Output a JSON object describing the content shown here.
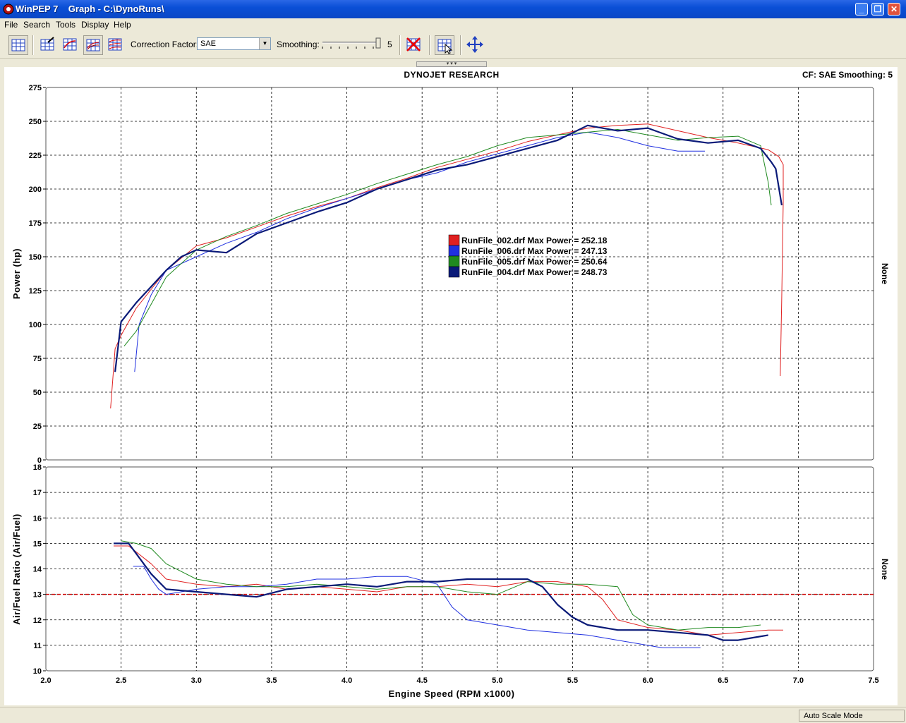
{
  "window": {
    "title": "WinPEP 7    Graph - C:\\DynoRuns\\",
    "minimize_label": "_",
    "maximize_label": "❐",
    "close_label": "✕"
  },
  "menu": [
    "File",
    "Search",
    "Tools",
    "Display",
    "Help"
  ],
  "toolbar": {
    "correction_label": "Correction Factor:",
    "correction_value": "SAE",
    "smoothing_label": "Smoothing:",
    "smoothing_value": "5"
  },
  "graph": {
    "header_title": "DYNOJET RESEARCH",
    "header_right": "CF: SAE  Smoothing: 5",
    "right_axis_label_top": "None",
    "right_axis_label_bottom": "None"
  },
  "status": {
    "mode": "Auto Scale Mode"
  },
  "colors": {
    "run002": "#e02020",
    "run006": "#2030e0",
    "run005": "#208a20",
    "run004": "#0a1a78",
    "afr_ref": "#cc0000",
    "grid": "#000000"
  },
  "chart_data": [
    {
      "type": "line",
      "xlabel": "",
      "ylabel": "Power (hp)",
      "xlim": [
        2.0,
        7.5
      ],
      "ylim": [
        0,
        275
      ],
      "xticks": [
        "2.0",
        "2.5",
        "3.0",
        "3.5",
        "4.0",
        "4.5",
        "5.0",
        "5.5",
        "6.0",
        "6.5",
        "7.0",
        "7.5"
      ],
      "yticks": [
        "0",
        "25",
        "50",
        "75",
        "100",
        "125",
        "150",
        "175",
        "200",
        "225",
        "250",
        "275"
      ],
      "grid": true,
      "legend": [
        "RunFile_002.drf Max Power = 252.18",
        "RunFile_006.drf Max Power = 247.13",
        "RunFile_005.drf Max Power = 250.64",
        "RunFile_004.drf Max Power = 248.73"
      ],
      "series": [
        {
          "name": "RunFile_002.drf",
          "color": "#e02020",
          "x": [
            2.43,
            2.46,
            2.5,
            2.6,
            2.8,
            3.0,
            3.2,
            3.4,
            3.6,
            3.8,
            4.0,
            4.2,
            4.4,
            4.6,
            4.8,
            5.0,
            5.2,
            5.4,
            5.6,
            5.8,
            6.0,
            6.2,
            6.4,
            6.6,
            6.8,
            6.87,
            6.9,
            6.9,
            6.89,
            6.88
          ],
          "y": [
            38,
            82,
            92,
            112,
            140,
            158,
            164,
            172,
            180,
            187,
            193,
            201,
            208,
            216,
            222,
            228,
            235,
            240,
            245,
            247,
            248,
            243,
            238,
            234,
            229,
            224,
            218,
            190,
            120,
            62
          ]
        },
        {
          "name": "RunFile_006.drf",
          "color": "#2030e0",
          "x": [
            2.59,
            2.62,
            2.7,
            2.8,
            3.0,
            3.2,
            3.4,
            3.6,
            3.8,
            4.0,
            4.2,
            4.4,
            4.6,
            4.8,
            5.0,
            5.2,
            5.4,
            5.6,
            5.8,
            6.0,
            6.2,
            6.38
          ],
          "y": [
            65,
            100,
            122,
            140,
            150,
            160,
            168,
            178,
            186,
            193,
            200,
            207,
            212,
            220,
            226,
            232,
            238,
            242,
            238,
            232,
            228,
            228
          ]
        },
        {
          "name": "RunFile_005.drf",
          "color": "#208a20",
          "x": [
            2.52,
            2.6,
            2.8,
            3.0,
            3.2,
            3.4,
            3.6,
            3.8,
            4.0,
            4.2,
            4.4,
            4.6,
            4.8,
            5.0,
            5.2,
            5.4,
            5.6,
            5.8,
            6.0,
            6.2,
            6.4,
            6.6,
            6.75,
            6.8,
            6.82
          ],
          "y": [
            84,
            95,
            135,
            155,
            165,
            173,
            182,
            189,
            196,
            204,
            211,
            218,
            224,
            232,
            238,
            240,
            242,
            244,
            240,
            236,
            238,
            239,
            232,
            205,
            188
          ]
        },
        {
          "name": "RunFile_004.drf",
          "color": "#0a1a78",
          "x": [
            2.46,
            2.5,
            2.6,
            2.7,
            2.8,
            2.9,
            3.0,
            3.2,
            3.4,
            3.6,
            3.8,
            4.0,
            4.2,
            4.4,
            4.6,
            4.8,
            5.0,
            5.2,
            5.4,
            5.6,
            5.8,
            6.0,
            6.2,
            6.4,
            6.6,
            6.75,
            6.82,
            6.85,
            6.89
          ],
          "y": [
            65,
            102,
            116,
            128,
            140,
            150,
            155,
            153,
            167,
            175,
            183,
            190,
            200,
            207,
            214,
            218,
            224,
            230,
            236,
            247,
            243,
            245,
            237,
            234,
            236,
            230,
            220,
            215,
            188
          ]
        }
      ]
    },
    {
      "type": "line",
      "xlabel": "Engine Speed (RPM x1000)",
      "ylabel": "Air/Fuel Ratio (Air/Fuel)",
      "xlim": [
        2.0,
        7.5
      ],
      "ylim": [
        10,
        18
      ],
      "xticks": [
        "2.0",
        "2.5",
        "3.0",
        "3.5",
        "4.0",
        "4.5",
        "5.0",
        "5.5",
        "6.0",
        "6.5",
        "7.0",
        "7.5"
      ],
      "yticks": [
        "10",
        "11",
        "12",
        "13",
        "14",
        "15",
        "16",
        "17",
        "18"
      ],
      "grid": true,
      "reference_line": 13,
      "series": [
        {
          "name": "RunFile_002.drf",
          "color": "#e02020",
          "x": [
            2.45,
            2.55,
            2.7,
            2.8,
            3.0,
            3.2,
            3.4,
            3.6,
            3.8,
            4.0,
            4.2,
            4.4,
            4.6,
            4.8,
            5.0,
            5.2,
            5.4,
            5.6,
            5.7,
            5.8,
            6.0,
            6.2,
            6.4,
            6.6,
            6.8,
            6.9
          ],
          "y": [
            14.9,
            14.9,
            14.2,
            13.6,
            13.4,
            13.3,
            13.4,
            13.2,
            13.3,
            13.2,
            13.1,
            13.3,
            13.3,
            13.4,
            13.3,
            13.5,
            13.5,
            13.3,
            12.8,
            12.0,
            11.7,
            11.6,
            11.4,
            11.5,
            11.6,
            11.6
          ]
        },
        {
          "name": "RunFile_006.drf",
          "color": "#2030e0",
          "x": [
            2.58,
            2.65,
            2.7,
            2.75,
            2.8,
            3.0,
            3.2,
            3.4,
            3.6,
            3.8,
            4.0,
            4.2,
            4.4,
            4.6,
            4.7,
            4.8,
            5.0,
            5.2,
            5.4,
            5.6,
            5.8,
            6.0,
            6.1,
            6.2,
            6.3,
            6.35
          ],
          "y": [
            14.1,
            14.1,
            13.6,
            13.2,
            13.0,
            13.2,
            13.3,
            13.3,
            13.4,
            13.6,
            13.6,
            13.7,
            13.7,
            13.4,
            12.5,
            12.0,
            11.8,
            11.6,
            11.5,
            11.4,
            11.2,
            11.0,
            10.9,
            10.9,
            10.9,
            10.9
          ]
        },
        {
          "name": "RunFile_005.drf",
          "color": "#208a20",
          "x": [
            2.5,
            2.6,
            2.7,
            2.8,
            3.0,
            3.2,
            3.4,
            3.6,
            3.8,
            4.0,
            4.2,
            4.4,
            4.6,
            4.8,
            5.0,
            5.2,
            5.4,
            5.6,
            5.8,
            5.9,
            6.0,
            6.2,
            6.4,
            6.6,
            6.75
          ],
          "y": [
            15.1,
            15.0,
            14.8,
            14.2,
            13.6,
            13.4,
            13.3,
            13.3,
            13.4,
            13.3,
            13.2,
            13.3,
            13.3,
            13.1,
            13.0,
            13.5,
            13.4,
            13.4,
            13.3,
            12.2,
            11.8,
            11.6,
            11.7,
            11.7,
            11.8
          ]
        },
        {
          "name": "RunFile_004.drf",
          "color": "#0a1a78",
          "x": [
            2.45,
            2.55,
            2.6,
            2.7,
            2.8,
            3.0,
            3.2,
            3.4,
            3.6,
            3.8,
            4.0,
            4.2,
            4.4,
            4.6,
            4.8,
            5.0,
            5.2,
            5.3,
            5.4,
            5.5,
            5.6,
            5.8,
            6.0,
            6.2,
            6.4,
            6.5,
            6.6,
            6.7,
            6.8
          ],
          "y": [
            15.0,
            15.0,
            14.6,
            13.8,
            13.2,
            13.1,
            13.0,
            12.9,
            13.2,
            13.3,
            13.4,
            13.3,
            13.5,
            13.5,
            13.6,
            13.6,
            13.6,
            13.3,
            12.6,
            12.1,
            11.8,
            11.6,
            11.6,
            11.5,
            11.4,
            11.2,
            11.2,
            11.3,
            11.4
          ]
        }
      ]
    }
  ]
}
